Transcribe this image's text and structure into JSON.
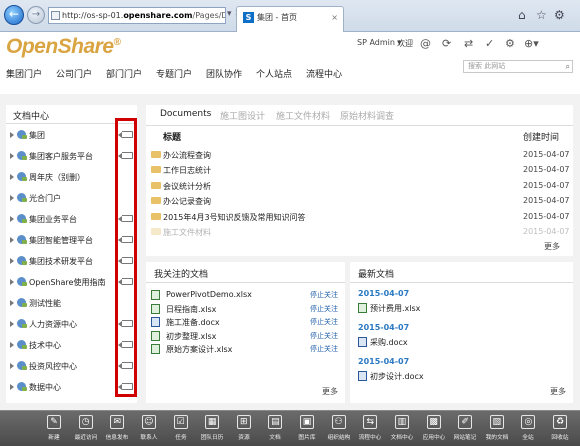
{
  "browser": {
    "url_prefix": "http://os-sp-01.",
    "url_host": "openshare.com",
    "url_path": "/Pages/Doc",
    "tab_title": "集团 - 首页",
    "favicon_letter": "S",
    "tab_close": "×",
    "addr_tools": "▾ ✕",
    "icons": [
      "home-icon",
      "star-icon",
      "gear-icon"
    ]
  },
  "header": {
    "logo": "OpenShare",
    "logo_mark": "®",
    "user": "SP Admin ▾",
    "welcome": "欢迎",
    "icons": {
      "at": "@",
      "sync": "⟳",
      "share": "⇄",
      "follow": "✓",
      "settings": "⚙",
      "language": "⊕▾"
    },
    "search_placeholder": "搜索 此网站",
    "search_icon": "⌕"
  },
  "global_nav": [
    "集团门户",
    "公司门户",
    "部门门户",
    "专题门户",
    "团队协作",
    "个人站点",
    "流程中心"
  ],
  "doc_center": {
    "title": "文档中心",
    "items": [
      {
        "label": "集团",
        "tag": true
      },
      {
        "label": "集团客户服务平台",
        "tag": true
      },
      {
        "label": "周年庆（别删）",
        "tag": false
      },
      {
        "label": "光合门户",
        "tag": false
      },
      {
        "label": "集团业务平台",
        "tag": true
      },
      {
        "label": "集团智能管理平台",
        "tag": true
      },
      {
        "label": "集团技术研发平台",
        "tag": true
      },
      {
        "label": "OpenShare使用指南",
        "tag": true
      },
      {
        "label": "测试性能",
        "tag": false
      },
      {
        "label": "人力资源中心",
        "tag": true
      },
      {
        "label": "技术中心",
        "tag": true
      },
      {
        "label": "投资风控中心",
        "tag": true
      },
      {
        "label": "数据中心",
        "tag": true
      }
    ]
  },
  "documents": {
    "tabs": [
      "Documents",
      "施工图设计",
      "施工文件材料",
      "原始材料调查"
    ],
    "col_title": "标题",
    "col_time": "创建时间",
    "rows": [
      {
        "name": "办公流程查询",
        "date": "2015-04-07"
      },
      {
        "name": "工作日志统计",
        "date": "2015-04-07"
      },
      {
        "name": "会议统计分析",
        "date": "2015-04-07"
      },
      {
        "name": "办公记录查询",
        "date": "2015-04-07"
      },
      {
        "name": "2015年4月3号知识反馈及常用知识问答",
        "date": "2015-04-07"
      },
      {
        "name": "施工文件材料",
        "date": "2015-04-07"
      }
    ],
    "more": "更多"
  },
  "followed": {
    "title": "我关注的文档",
    "unfollow_label": "停止关注",
    "items": [
      {
        "name": "PowerPivotDemo.xlsx",
        "type": "excel"
      },
      {
        "name": "日程指南.xlsx",
        "type": "excel"
      },
      {
        "name": "施工准备.docx",
        "type": "word"
      },
      {
        "name": "初步整理.xlsx",
        "type": "excel"
      },
      {
        "name": "原始方案设计.xlsx",
        "type": "excel"
      }
    ],
    "more": "更多"
  },
  "latest": {
    "title": "最新文档",
    "groups": [
      {
        "date": "2015-04-07",
        "files": [
          {
            "name": "预计费用.xlsx",
            "type": "excel"
          }
        ]
      },
      {
        "date": "2015-04-07",
        "files": [
          {
            "name": "采购.docx",
            "type": "word"
          }
        ]
      },
      {
        "date": "2015-04-07",
        "files": [
          {
            "name": "初步设计.docx",
            "type": "word"
          }
        ]
      }
    ],
    "more": "更多"
  },
  "toolbar": {
    "items": [
      {
        "label": "新建",
        "icon": "new-icon",
        "glyph": "✎"
      },
      {
        "label": "最近访问",
        "icon": "recent-icon",
        "glyph": "◷"
      },
      {
        "label": "信息发布",
        "icon": "publish-icon",
        "glyph": "✉"
      },
      {
        "label": "联系人",
        "icon": "contacts-icon",
        "glyph": "☺"
      },
      {
        "label": "任务",
        "icon": "task-icon",
        "glyph": "☑"
      },
      {
        "label": "团队日历",
        "icon": "calendar-icon",
        "glyph": "▦"
      },
      {
        "label": "资源",
        "icon": "resource-icon",
        "glyph": "⊞"
      },
      {
        "label": "文档",
        "icon": "document-icon",
        "glyph": "▤"
      },
      {
        "label": "图片库",
        "icon": "picture-icon",
        "glyph": "▣"
      },
      {
        "label": "组织结构",
        "icon": "org-icon",
        "glyph": "⚇"
      },
      {
        "label": "流程中心",
        "icon": "workflow-icon",
        "glyph": "⇆"
      },
      {
        "label": "文档中心",
        "icon": "doccenter-icon",
        "glyph": "▥"
      },
      {
        "label": "应用中心",
        "icon": "apps-icon",
        "glyph": "▩"
      },
      {
        "label": "网站笔记",
        "icon": "notes-icon",
        "glyph": "✐"
      },
      {
        "label": "我的文档",
        "icon": "mydocs-icon",
        "glyph": "▧"
      },
      {
        "label": "全站",
        "icon": "site-icon",
        "glyph": "◎"
      },
      {
        "label": "回收站",
        "icon": "recycle-icon",
        "glyph": "♻"
      }
    ]
  }
}
